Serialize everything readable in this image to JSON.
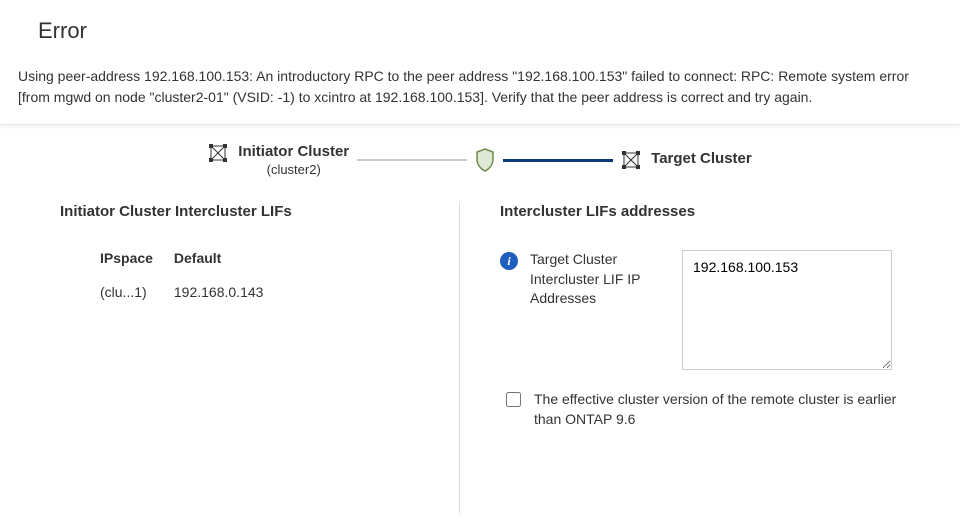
{
  "error": {
    "title": "Error",
    "message": "Using peer-address 192.168.100.153: An introductory RPC to the peer address \"192.168.100.153\" failed to connect: RPC: Remote system error [from mgwd on node \"cluster2-01\" (VSID: -1) to xcintro at 192.168.100.153]. Verify that the peer address is correct and try again."
  },
  "diagram": {
    "initiator": {
      "label": "Initiator Cluster",
      "sub": "(cluster2)"
    },
    "target": {
      "label": "Target Cluster"
    }
  },
  "left": {
    "section_title": "Initiator Cluster Intercluster LIFs",
    "header_col1": "IPspace",
    "header_col2": "Default",
    "row_col1": "(clu...1)",
    "row_col2": "192.168.0.143"
  },
  "right": {
    "section_title": "Intercluster LIFs addresses",
    "field_label": "Target Cluster Intercluster LIF IP Addresses",
    "ip_value": "192.168.100.153",
    "checkbox_label": "The effective cluster version of the remote cluster is earlier than ONTAP 9.6"
  }
}
